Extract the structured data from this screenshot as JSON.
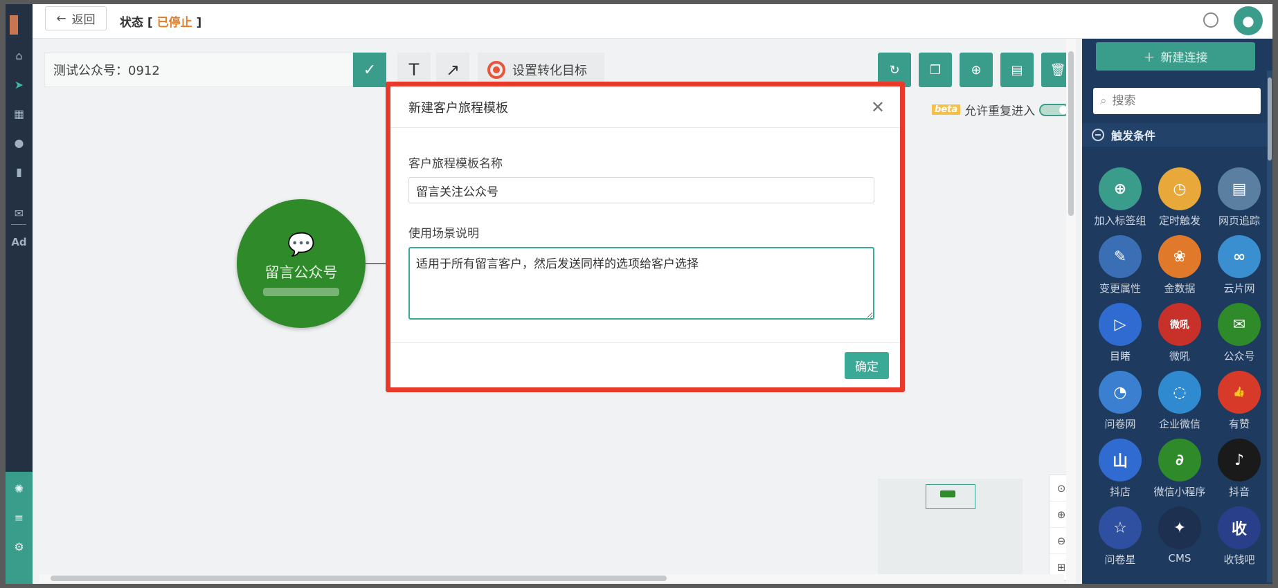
{
  "topbar": {
    "back_label": "返回",
    "status_label": "状态",
    "status_value": "已停止"
  },
  "canvas": {
    "journey_name": "测试公众号：0912",
    "goal_label": "设置转化目标",
    "beta_tag": "beta",
    "repeat_entry_label": "允许重复进入",
    "node_label": "留言公众号"
  },
  "leftnav": {
    "ad_label": "Ad"
  },
  "rightpanel": {
    "new_connection_label": "新建连接",
    "search_placeholder": "搜索",
    "trigger_section_label": "触发条件",
    "items": [
      {
        "label": "加入标签组",
        "icon": "add-user-icon",
        "color": "#3a9d8c"
      },
      {
        "label": "定时触发",
        "icon": "clock-icon",
        "color": "#e8a83a"
      },
      {
        "label": "网页追踪",
        "icon": "webpage-icon",
        "color": "#5a7fa0"
      },
      {
        "label": "变更属性",
        "icon": "edit-icon",
        "color": "#3b6fb5"
      },
      {
        "label": "金数据",
        "icon": "jinshuju-icon",
        "color": "#e07a2a"
      },
      {
        "label": "云片网",
        "icon": "cloud-icon",
        "color": "#3a8fd0"
      },
      {
        "label": "目睹",
        "icon": "play-icon",
        "color": "#2f6bd0"
      },
      {
        "label": "微吼",
        "icon": "weihou-icon",
        "color": "#c8302a"
      },
      {
        "label": "公众号",
        "icon": "wechat-icon",
        "color": "#2f8a2a"
      },
      {
        "label": "问卷网",
        "icon": "wenjuan-icon",
        "color": "#3a7fd0"
      },
      {
        "label": "企业微信",
        "icon": "work-wechat-icon",
        "color": "#2f8ad0"
      },
      {
        "label": "有赞",
        "icon": "thumb-up-icon",
        "color": "#d83a2a"
      },
      {
        "label": "抖店",
        "icon": "doudian-icon",
        "color": "#2f6bd0"
      },
      {
        "label": "微信小程序",
        "icon": "mini-program-icon",
        "color": "#2f8a2a"
      },
      {
        "label": "抖音",
        "icon": "tiktok-icon",
        "color": "#1a1a1a"
      },
      {
        "label": "问卷星",
        "icon": "star-icon",
        "color": "#2f4fa0"
      },
      {
        "label": "CMS",
        "icon": "cms-icon",
        "color": "#1e3050"
      },
      {
        "label": "收钱吧",
        "icon": "shouqianba-icon",
        "color": "#2a3f8a"
      }
    ],
    "icon_glyphs": [
      "⊕",
      "◷",
      "▤",
      "✎",
      "❀",
      "∞",
      "▷",
      "微吼",
      "✉",
      "◔",
      "◌",
      "👍",
      "山",
      "∂",
      "♪",
      "☆",
      "✦",
      "收"
    ]
  },
  "modal": {
    "title": "新建客户旅程模板",
    "name_label": "客户旅程模板名称",
    "name_value": "留言关注公众号",
    "desc_label": "使用场景说明",
    "desc_value": "适用于所有留言客户，然后发送同样的选项给客户选择",
    "confirm_label": "确定"
  },
  "colors": {
    "accent": "#3a9d8c",
    "highlight": "#e8392b",
    "status_stopped": "#e0802a"
  }
}
